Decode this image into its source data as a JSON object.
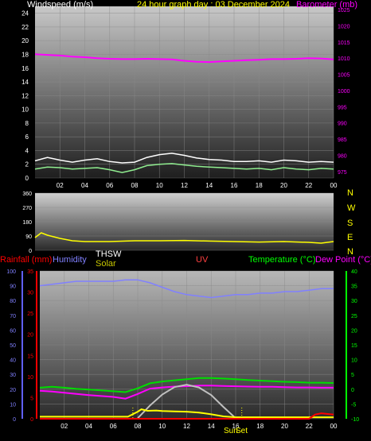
{
  "header": {
    "windspeed_label": "Windspeed (m/s)",
    "title": "24 hour graph day : 03 December 2024",
    "barometer_label": "Barometer (mb)"
  },
  "middle": {
    "compass": [
      "N",
      "W",
      "S",
      "E",
      "N"
    ]
  },
  "bottom": {
    "rainfall_label": "Rainfall (mm)",
    "humidity_label": "Humidity",
    "thsw_label": "THSW",
    "solar_label": "Solar",
    "uv_label": "UV",
    "temperature_label": "Temperature (°C)",
    "dewpoint_label": "Dew Point (°C)",
    "sunrise_label": "Sun",
    "sunset_label": "Set"
  },
  "colors": {
    "wind_avg": "#ffffff",
    "wind_gust": "#90ee90",
    "barometer": "#ff00ff",
    "direction": "#ffff00",
    "humidity": "#8080ff",
    "temperature": "#00dd00",
    "dewpoint": "#ff00ff",
    "solar": "#c0c0c0",
    "uv": "#ffff00",
    "rain": "#ff0000",
    "temp_axis": "#00ff00"
  },
  "chart_data": [
    {
      "type": "line",
      "name": "wind-barometer",
      "x_ticks": [
        "02",
        "04",
        "06",
        "08",
        "10",
        "12",
        "14",
        "16",
        "18",
        "20",
        "22",
        "00"
      ],
      "y_left_ticks": [
        0,
        2,
        4,
        6,
        8,
        10,
        12,
        14,
        16,
        18,
        20,
        22,
        24
      ],
      "y_left_range": [
        0,
        25
      ],
      "y_right_ticks": [
        975,
        980,
        985,
        990,
        995,
        1000,
        1005,
        1010,
        1015,
        1020,
        1025
      ],
      "y_right_range": [
        973,
        1026
      ],
      "series": [
        {
          "axis": "left",
          "color_key": "wind_avg",
          "x": [
            0,
            1,
            2,
            3,
            4,
            5,
            6,
            7,
            8,
            9,
            10,
            11,
            12,
            13,
            14,
            15,
            16,
            17,
            18,
            19,
            20,
            21,
            22,
            23,
            24
          ],
          "y": [
            2.5,
            3,
            2.6,
            2.3,
            2.6,
            2.8,
            2.4,
            2.2,
            2.3,
            3,
            3.4,
            3.6,
            3.3,
            2.9,
            2.7,
            2.6,
            2.4,
            2.4,
            2.5,
            2.3,
            2.6,
            2.5,
            2.3,
            2.4,
            2.3
          ]
        },
        {
          "axis": "left",
          "color_key": "wind_gust",
          "x": [
            0,
            1,
            2,
            3,
            4,
            5,
            6,
            7,
            8,
            9,
            10,
            11,
            12,
            13,
            14,
            15,
            16,
            17,
            18,
            19,
            20,
            21,
            22,
            23,
            24
          ],
          "y": [
            1.3,
            1.6,
            1.5,
            1.3,
            1.4,
            1.5,
            1.2,
            0.8,
            1.2,
            1.8,
            2,
            2.1,
            1.9,
            1.7,
            1.6,
            1.5,
            1.4,
            1.3,
            1.4,
            1.2,
            1.5,
            1.3,
            1.2,
            1.4,
            1.3
          ]
        },
        {
          "axis": "right",
          "color_key": "barometer",
          "x": [
            0,
            1,
            2,
            3,
            4,
            5,
            6,
            7,
            8,
            9,
            10,
            11,
            12,
            13,
            14,
            15,
            16,
            17,
            18,
            19,
            20,
            21,
            22,
            23,
            24
          ],
          "y": [
            1011.2,
            1011,
            1010.8,
            1010.5,
            1010.3,
            1010,
            1009.8,
            1009.7,
            1009.7,
            1009.8,
            1009.7,
            1009.6,
            1009.2,
            1008.9,
            1008.8,
            1009,
            1009.2,
            1009.4,
            1009.5,
            1009.7,
            1009.7,
            1009.8,
            1010,
            1009.9,
            1009.6
          ]
        }
      ]
    },
    {
      "type": "line",
      "name": "wind-direction",
      "y_ticks": [
        0,
        90,
        180,
        270,
        360
      ],
      "y_range": [
        0,
        360
      ],
      "series": [
        {
          "color_key": "direction",
          "x": [
            0,
            0.5,
            1,
            1.5,
            2,
            3,
            4,
            6,
            8,
            10,
            12,
            14,
            16,
            18,
            20,
            22,
            23,
            24
          ],
          "y": [
            80,
            110,
            95,
            85,
            75,
            60,
            55,
            55,
            60,
            60,
            62,
            58,
            55,
            52,
            55,
            50,
            45,
            55
          ]
        }
      ]
    },
    {
      "type": "line",
      "name": "temperature-humidity",
      "x_ticks": [
        "02",
        "04",
        "06",
        "08",
        "10",
        "12",
        "14",
        "16",
        "18",
        "20",
        "22",
        "00"
      ],
      "humidity_ticks": [
        0,
        10,
        20,
        30,
        40,
        50,
        60,
        70,
        80,
        90,
        100
      ],
      "humidity_range": [
        0,
        100
      ],
      "rain_ticks": [
        0,
        5,
        10,
        15,
        20,
        25,
        30,
        35
      ],
      "rain_range": [
        0,
        35
      ],
      "temp_ticks": [
        -10,
        -5,
        0,
        5,
        10,
        15,
        20,
        25,
        30,
        35,
        40
      ],
      "temp_range": [
        -10,
        40
      ],
      "series": [
        {
          "axis": "humidity",
          "color_key": "humidity",
          "x": [
            0,
            1,
            2,
            3,
            4,
            5,
            6,
            7,
            8,
            9,
            10,
            11,
            12,
            13,
            14,
            15,
            16,
            17,
            18,
            19,
            20,
            21,
            22,
            23,
            24
          ],
          "y": [
            90,
            91,
            92,
            93,
            93,
            93,
            93,
            94,
            94,
            92,
            89,
            86,
            84,
            83,
            82,
            83,
            84,
            84,
            85,
            85,
            86,
            86,
            87,
            88,
            88
          ]
        },
        {
          "axis": "temp",
          "color_key": "temperature",
          "x": [
            0,
            1,
            2,
            3,
            4,
            5,
            6,
            7,
            8,
            9,
            10,
            11,
            12,
            13,
            14,
            15,
            16,
            17,
            18,
            19,
            20,
            21,
            22,
            23,
            24
          ],
          "y": [
            0.5,
            0.8,
            0.5,
            0.1,
            -0.1,
            -0.4,
            -0.7,
            -1,
            0.3,
            2,
            2.6,
            3,
            3.4,
            3.8,
            3.8,
            3.6,
            3.4,
            3.1,
            2.9,
            2.7,
            2.5,
            2.4,
            2.2,
            2.2,
            2.1
          ]
        },
        {
          "axis": "temp",
          "color_key": "dewpoint",
          "x": [
            0,
            1,
            2,
            3,
            4,
            5,
            6,
            7,
            8,
            9,
            10,
            11,
            12,
            13,
            14,
            15,
            16,
            17,
            18,
            19,
            20,
            21,
            22,
            23,
            24
          ],
          "y": [
            -0.5,
            -0.8,
            -1.2,
            -1.6,
            -2,
            -2.3,
            -2.6,
            -3.2,
            -1.6,
            0.2,
            0.6,
            0.9,
            1,
            1.2,
            1.2,
            1.1,
            1,
            0.9,
            0.8,
            0.8,
            0.7,
            0.6,
            0.6,
            0.5,
            0.5
          ]
        },
        {
          "axis": "temp",
          "color_key": "solar",
          "x": [
            8,
            9,
            10,
            11,
            12,
            13,
            14,
            15,
            16
          ],
          "y": [
            -9.8,
            -5.5,
            -1.8,
            0.7,
            1.5,
            0.6,
            -2,
            -6,
            -9.8
          ]
        },
        {
          "axis": "temp",
          "color_key": "uv",
          "x": [
            0,
            7.2,
            8,
            8.3,
            8.8,
            9.5,
            10,
            11,
            12,
            13,
            14,
            15,
            16,
            24
          ],
          "y": [
            -9.3,
            -9.3,
            -7.6,
            -6.8,
            -7.3,
            -7.2,
            -7.4,
            -7.5,
            -7.6,
            -7.9,
            -8.5,
            -9.2,
            -9.5,
            -9.5
          ]
        },
        {
          "axis": "rain",
          "color_key": "rain",
          "x": [
            0,
            22,
            22.5,
            23,
            24
          ],
          "y": [
            0,
            0,
            1,
            1.3,
            1
          ]
        }
      ]
    }
  ]
}
